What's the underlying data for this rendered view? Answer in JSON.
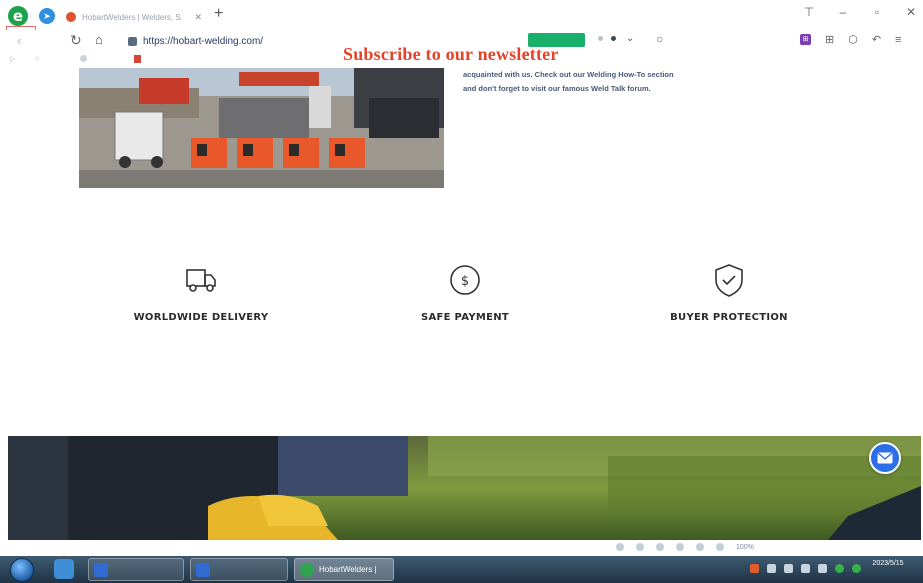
{
  "browser": {
    "logo_letter": "e",
    "logo_tag": "",
    "tab": {
      "title": "HobartWelders | Welders, S"
    },
    "url": "https://hobart-welding.com/",
    "green_pill": "",
    "bookmarks": [
      {
        "label": ""
      },
      {
        "label": ""
      },
      {
        "label": ""
      }
    ]
  },
  "hero": {
    "text_lines": [
      "acquainted with us. Check out our Welding How-To section",
      "and don't forget to visit our famous Weld Talk forum."
    ]
  },
  "features": [
    {
      "icon": "truck-icon",
      "title": "WORLDWIDE DELIVERY",
      "desc": ""
    },
    {
      "icon": "dollar-coin-icon",
      "title": "SAFE PAYMENT",
      "desc": ""
    },
    {
      "icon": "shield-check-icon",
      "title": "BUYER PROTECTION",
      "desc": ""
    }
  ],
  "newsletter": {
    "title": "Subscribe to our newsletter",
    "subtitle": ""
  },
  "statusbar": {
    "zoom": "100%"
  },
  "taskbar": {
    "tasks": [
      {
        "label": ""
      },
      {
        "label": ""
      },
      {
        "label": "HobartWelders |"
      }
    ],
    "clock_time": "",
    "clock_date": "2023/5/15"
  },
  "colors": {
    "accent_green": "#19b06b",
    "newsletter_red": "#e4432b",
    "mail_button_blue": "#2c6ee8",
    "hobart_orange": "#e8582a"
  }
}
